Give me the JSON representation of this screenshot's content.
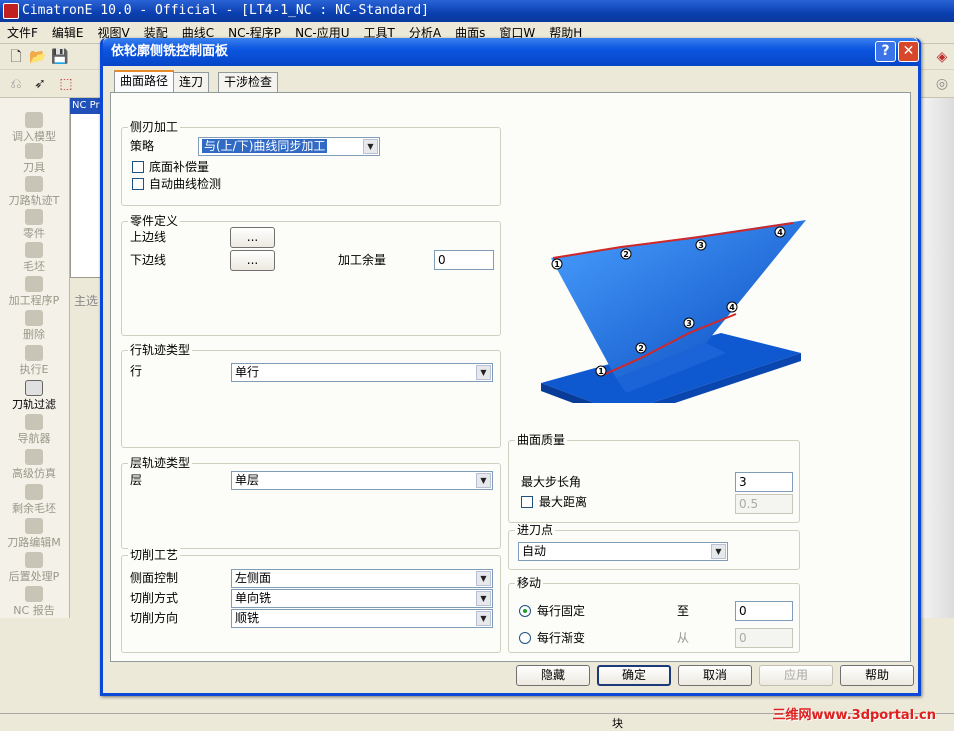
{
  "app": {
    "title": "CimatronE 10.0 - Official - [LT4-1_NC : NC-Standard]",
    "menus": [
      "文件F",
      "编辑E",
      "视图V",
      "装配",
      "曲线C",
      "NC-程序P",
      "NC-应用U",
      "工具T",
      "分析A",
      "曲面s",
      "窗口W",
      "帮助H"
    ]
  },
  "left_panel": {
    "items": [
      "调入模型",
      "刀具",
      "刀路轨迹T",
      "零件",
      "毛坯",
      "加工程序P",
      "删除",
      "执行E",
      "刀轨过滤",
      "导航器",
      "高级仿真",
      "剩余毛坯",
      "刀路编辑M",
      "后置处理P",
      "NC 报告"
    ],
    "active_item": "刀轨过滤"
  },
  "nc_panel": {
    "title": "NC Pr"
  },
  "bg_panel_label": "主选",
  "statusbar": {
    "cell": "块",
    "watermark": "三维网www.3dportal.cn"
  },
  "dialog": {
    "title": "依轮廓侧铣控制面板",
    "help_glyph": "?",
    "close_glyph": "✕",
    "tabs": [
      "曲面路径",
      "连刀",
      "干涉检查"
    ],
    "side_blade": {
      "group": "侧刃加工",
      "strategy_label": "策略",
      "strategy_value": "与(上/下)曲线同步加工",
      "check_bottom": "底面补偿量",
      "check_auto": "自动曲线检测"
    },
    "part_def": {
      "group": "零件定义",
      "upper_label": "上边线",
      "lower_label": "下边线",
      "pick_button": "...",
      "allowance_label": "加工余量",
      "allowance_value": "0"
    },
    "row_traj": {
      "group": "行轨迹类型",
      "label": "行",
      "value": "单行"
    },
    "layer_traj": {
      "group": "层轨迹类型",
      "label": "层",
      "value": "单层"
    },
    "cut_proc": {
      "group": "切削工艺",
      "side_label": "侧面控制",
      "side_value": "左侧面",
      "mode_label": "切削方式",
      "mode_value": "单向铣",
      "dir_label": "切削方向",
      "dir_value": "顺铣"
    },
    "surface_quality": {
      "group": "曲面质量",
      "max_step_label": "最大步长角",
      "max_step_value": "3",
      "max_dist_label": "最大距离",
      "max_dist_value": "0.5"
    },
    "entry": {
      "group": "进刀点",
      "value": "自动"
    },
    "move": {
      "group": "移动",
      "fixed_label": "每行固定",
      "to_label": "至",
      "to_value": "0",
      "gradual_label": "每行渐变",
      "from_label": "从",
      "from_value": "0"
    },
    "preview_points": [
      "1",
      "2",
      "3",
      "4",
      "1",
      "2",
      "3",
      "4"
    ],
    "buttons": {
      "hide": "隐藏",
      "ok": "确定",
      "cancel": "取消",
      "apply": "应用",
      "help": "帮助"
    },
    "colors": {
      "part": "#1a6ce0",
      "curve": "#d02828",
      "title_bar": "#0c55e0"
    }
  }
}
